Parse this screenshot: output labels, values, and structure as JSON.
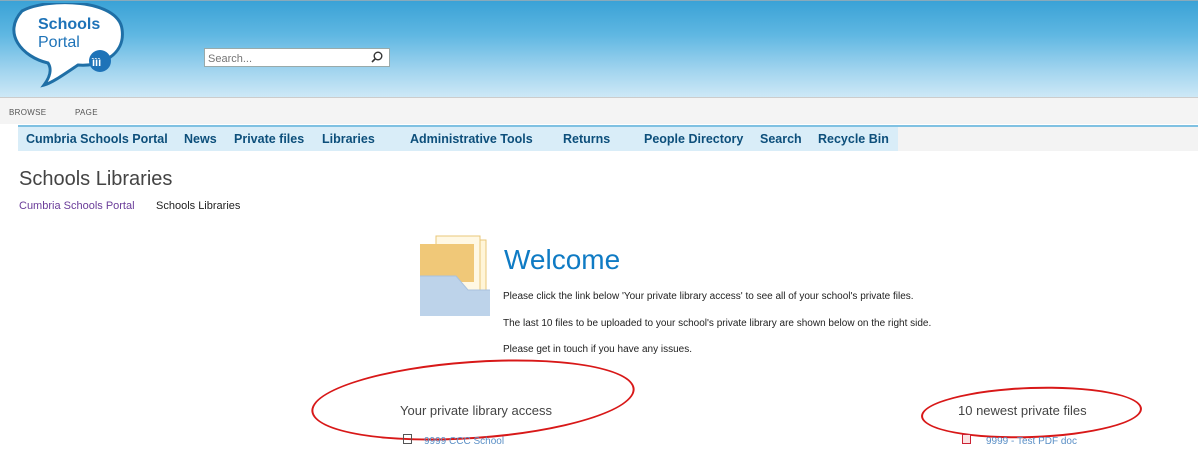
{
  "header": {
    "logo_text": "Schools Portal",
    "search_placeholder": "Search..."
  },
  "ribbon": {
    "browse": "BROWSE",
    "page": "PAGE"
  },
  "nav": {
    "items": [
      "Cumbria Schools Portal",
      "News",
      "Private files",
      "Libraries",
      "Administrative Tools",
      "Returns",
      "People Directory",
      "Search",
      "Recycle Bin"
    ]
  },
  "page": {
    "title": "Schools Libraries",
    "breadcrumb": {
      "root": "Cumbria Schools Portal",
      "current": "Schools Libraries"
    }
  },
  "welcome": {
    "title": "Welcome",
    "lines": [
      "Please click the link below 'Your private library access' to see all of your school's private files.",
      "The last 10 files to be uploaded to your school's private library are shown below on the right side.",
      "Please get in touch if you have any issues."
    ]
  },
  "sections": {
    "library_access": {
      "title": "Your private library access",
      "first_item": "9999 CCC School"
    },
    "newest_files": {
      "title": "10 newest private files",
      "first_item": "9999 - Test PDF doc"
    }
  },
  "colors": {
    "annotation": "#d81818",
    "link": "#0d4f7b",
    "accent": "#0f7bc4"
  }
}
